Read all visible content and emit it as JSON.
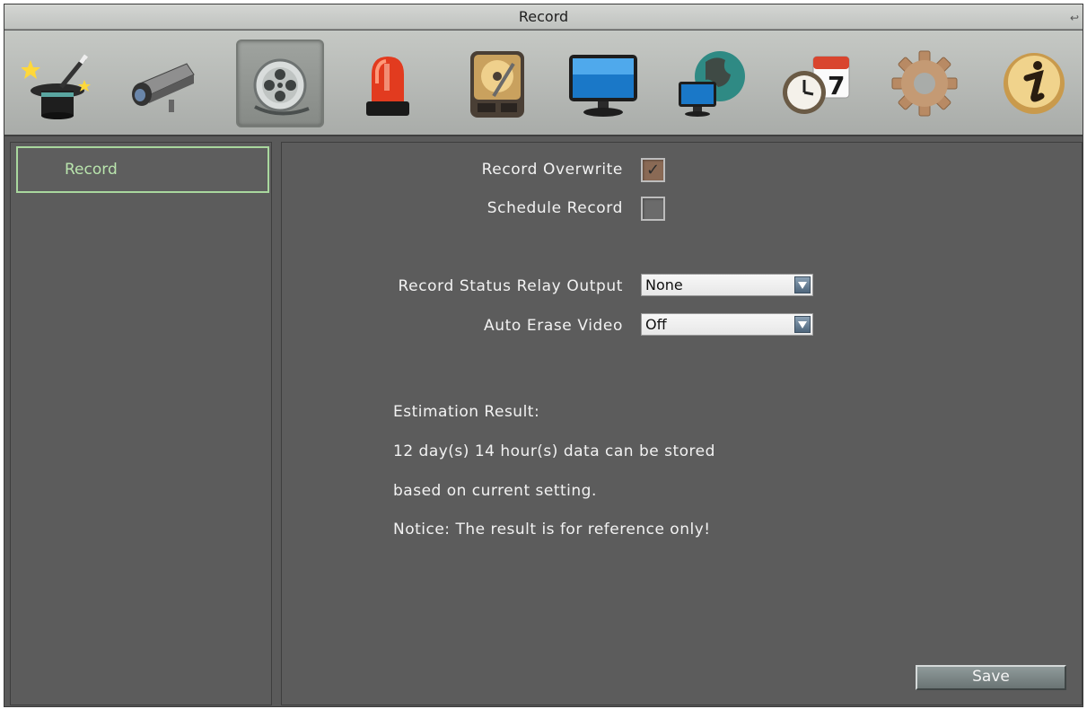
{
  "window": {
    "title": "Record"
  },
  "toolbar": {
    "icons": [
      "wizard-icon",
      "camera-icon",
      "record-icon",
      "alarm-icon",
      "disk-icon",
      "monitor-icon",
      "network-icon",
      "schedule-icon",
      "settings-icon",
      "info-icon"
    ],
    "selected": "record-icon"
  },
  "sidebar": {
    "items": [
      {
        "label": "Record",
        "active": true
      }
    ]
  },
  "form": {
    "record_overwrite": {
      "label": "Record Overwrite",
      "checked": true
    },
    "schedule_record": {
      "label": "Schedule Record",
      "checked": false
    },
    "relay_output": {
      "label": "Record Status Relay Output",
      "value": "None"
    },
    "auto_erase": {
      "label": "Auto Erase Video",
      "value": "Off"
    }
  },
  "estimation": {
    "heading": "Estimation Result:",
    "line1": "12 day(s) 14 hour(s) data can be stored",
    "line2": "based on current setting.",
    "notice": "Notice: The result is for reference only!"
  },
  "buttons": {
    "save": "Save"
  },
  "colors": {
    "accent_green": "#a9d89e",
    "panel": "#5c5c5c",
    "toolbar": "#b8bbb8"
  }
}
